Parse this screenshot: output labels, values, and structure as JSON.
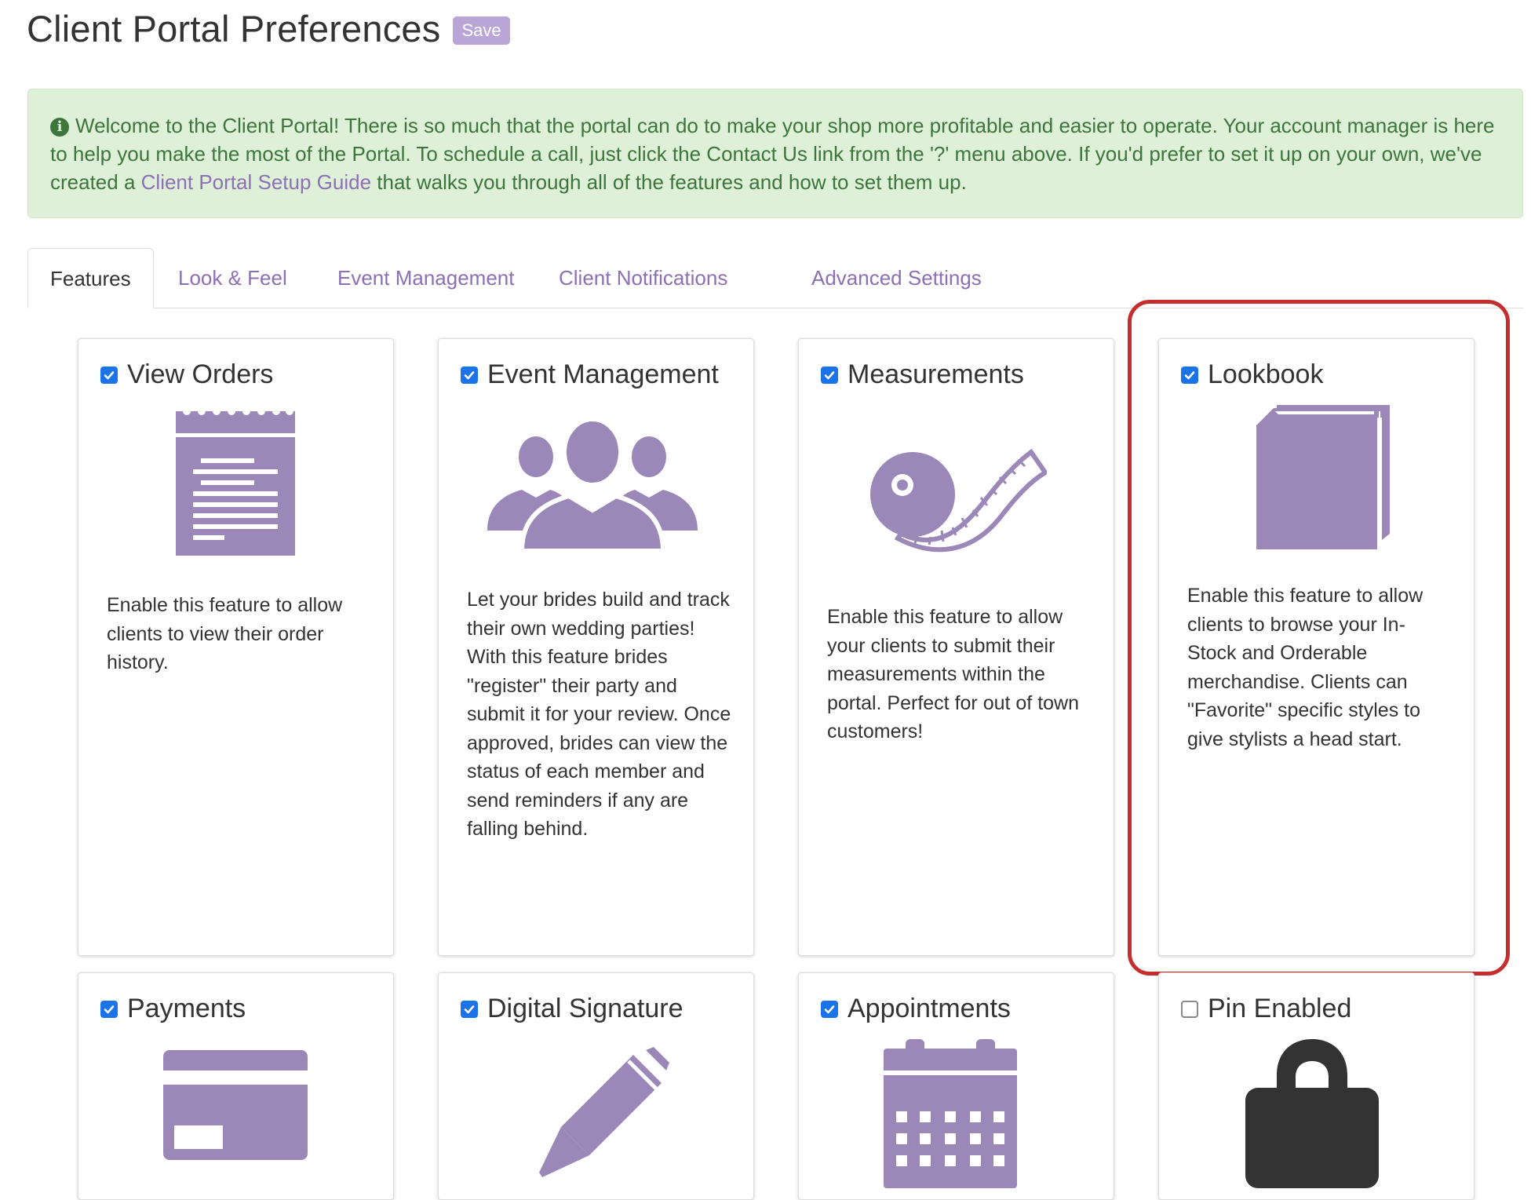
{
  "page": {
    "title": "Client Portal Preferences",
    "save_label": "Save"
  },
  "alert": {
    "text_before": "Welcome to the Client Portal! There is so much that the portal can do to make your shop more profitable and easier to operate. Your account manager is here to help you make the most of the Portal. To schedule a call, just click the Contact Us link from the '?' menu above. If you'd prefer to set it up on your own, we've created a ",
    "link_text": "Client Portal Setup Guide",
    "text_after": " that walks you through all of the features and how to set them up."
  },
  "tabs": [
    {
      "label": "Features",
      "active": true
    },
    {
      "label": "Look & Feel",
      "active": false
    },
    {
      "label": "Event Management",
      "active": false
    },
    {
      "label": "Client Notifications",
      "active": false
    },
    {
      "label": "Advanced Settings",
      "active": false
    }
  ],
  "features": [
    {
      "title": "View Orders",
      "checked": true,
      "icon": "order-notepad-icon",
      "description": "Enable this feature to allow clients to view their order history."
    },
    {
      "title": "Event Management",
      "checked": true,
      "icon": "group-people-icon",
      "description": "Let your brides build and track their own wedding parties! With this feature brides \"register\" their party and submit it for your review. Once approved, brides can view the status of each member and send reminders if any are falling behind."
    },
    {
      "title": "Measurements",
      "checked": true,
      "icon": "measuring-tape-icon",
      "description": "Enable this feature to allow your clients to submit their measurements within the portal. Perfect for out of town customers!"
    },
    {
      "title": "Lookbook",
      "checked": true,
      "icon": "book-icon",
      "description": "Enable this feature to allow clients to browse your In-Stock and Orderable merchandise. Clients can \"Favorite\" specific styles to give stylists a head start."
    },
    {
      "title": "Payments",
      "checked": true,
      "icon": "credit-card-icon",
      "description": ""
    },
    {
      "title": "Digital Signature",
      "checked": true,
      "icon": "pen-icon",
      "description": ""
    },
    {
      "title": "Appointments",
      "checked": true,
      "icon": "calendar-icon",
      "description": ""
    },
    {
      "title": "Pin Enabled",
      "checked": false,
      "icon": "lock-icon",
      "description": ""
    }
  ],
  "colors": {
    "accent": "#8c6fb5",
    "icon_purple": "#9b87b8",
    "alert_bg": "#dff0d8",
    "alert_text": "#3c763d",
    "highlight": "#c62d2d",
    "checkbox": "#1a73e8",
    "lock_icon": "#333333"
  }
}
